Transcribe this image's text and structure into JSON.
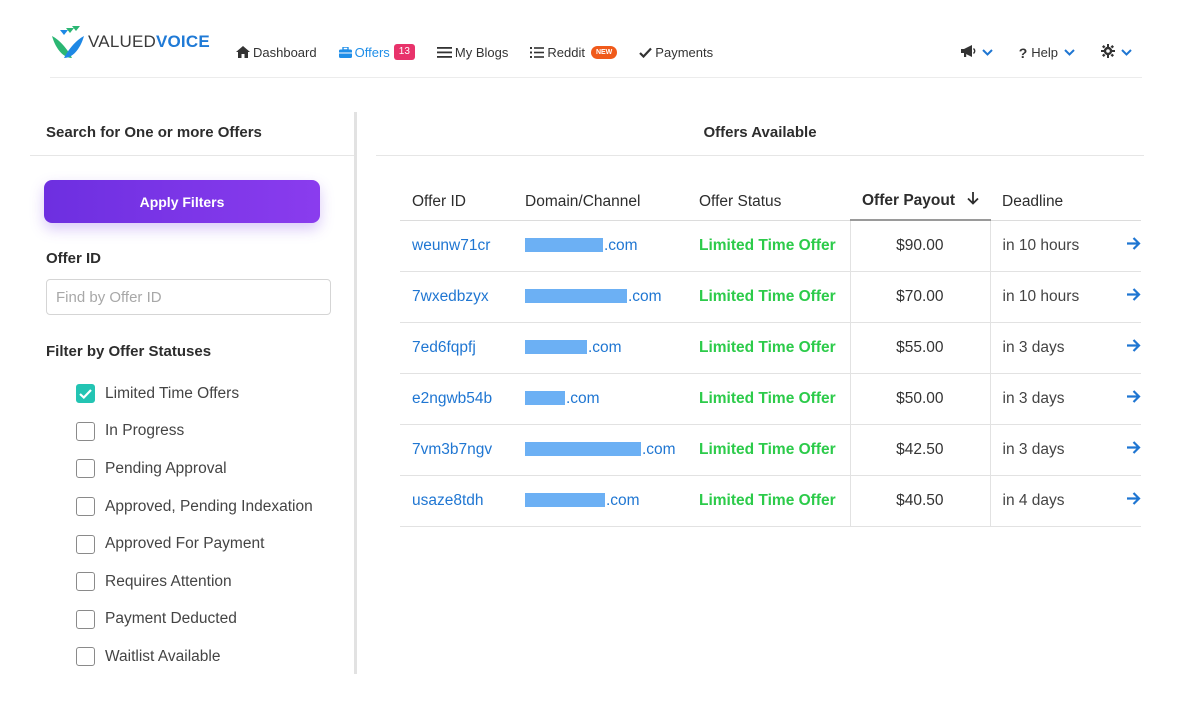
{
  "brand": {
    "part1": "VALUED",
    "part2": "VOICE"
  },
  "nav": {
    "dashboard": "Dashboard",
    "offers": "Offers",
    "offers_count": "13",
    "blogs": "My Blogs",
    "reddit": "Reddit",
    "reddit_badge": "NEW",
    "payments": "Payments",
    "help": "Help"
  },
  "filters": {
    "title": "Search for One or more Offers",
    "apply_label": "Apply Filters",
    "offer_id_label": "Offer ID",
    "offer_id_placeholder": "Find by Offer ID",
    "offer_id_value": "",
    "statuses_label": "Filter by Offer Statuses",
    "statuses": [
      {
        "label": "Limited Time Offers",
        "checked": true
      },
      {
        "label": "In Progress",
        "checked": false
      },
      {
        "label": "Pending Approval",
        "checked": false
      },
      {
        "label": "Approved, Pending Indexation",
        "checked": false
      },
      {
        "label": "Approved For Payment",
        "checked": false
      },
      {
        "label": "Requires Attention",
        "checked": false
      },
      {
        "label": "Payment Deducted",
        "checked": false
      },
      {
        "label": "Waitlist Available",
        "checked": false
      }
    ]
  },
  "offers": {
    "title": "Offers Available",
    "columns": {
      "id": "Offer ID",
      "domain": "Domain/Channel",
      "status": "Offer Status",
      "payout": "Offer Payout",
      "deadline": "Deadline"
    },
    "rows": [
      {
        "id": "weunw71cr",
        "domain_suffix": ".com",
        "status": "Limited Time Offer",
        "payout": "$90.00",
        "deadline": "in 10 hours"
      },
      {
        "id": "7wxedbzyx",
        "domain_suffix": ".com",
        "status": "Limited Time Offer",
        "payout": "$70.00",
        "deadline": "in 10 hours"
      },
      {
        "id": "7ed6fqpfj",
        "domain_suffix": ".com",
        "status": "Limited Time Offer",
        "payout": "$55.00",
        "deadline": "in 3 days"
      },
      {
        "id": "e2ngwb54b",
        "domain_suffix": ".com",
        "status": "Limited Time Offer",
        "payout": "$50.00",
        "deadline": "in 3 days"
      },
      {
        "id": "7vm3b7ngv",
        "domain_suffix": ".com",
        "status": "Limited Time Offer",
        "payout": "$42.50",
        "deadline": "in 3 days"
      },
      {
        "id": "usaze8tdh",
        "domain_suffix": ".com",
        "status": "Limited Time Offer",
        "payout": "$40.50",
        "deadline": "in 4 days"
      }
    ]
  },
  "colors": {
    "accent_blue": "#1f76d2",
    "status_green": "#2ccb4a",
    "apply_purple": "#7a35e8",
    "offers_badge": "#e8336b",
    "new_badge": "#f05a1a",
    "checkbox_teal": "#23c4b3"
  },
  "icons": {
    "dashboard": "home-icon",
    "offers": "briefcase-icon",
    "blogs": "lines-icon",
    "reddit": "list-icon",
    "payments": "check-icon",
    "announce": "megaphone-icon",
    "help": "question-icon",
    "settings": "gear-icon",
    "row_action": "arrow-right-icon"
  }
}
